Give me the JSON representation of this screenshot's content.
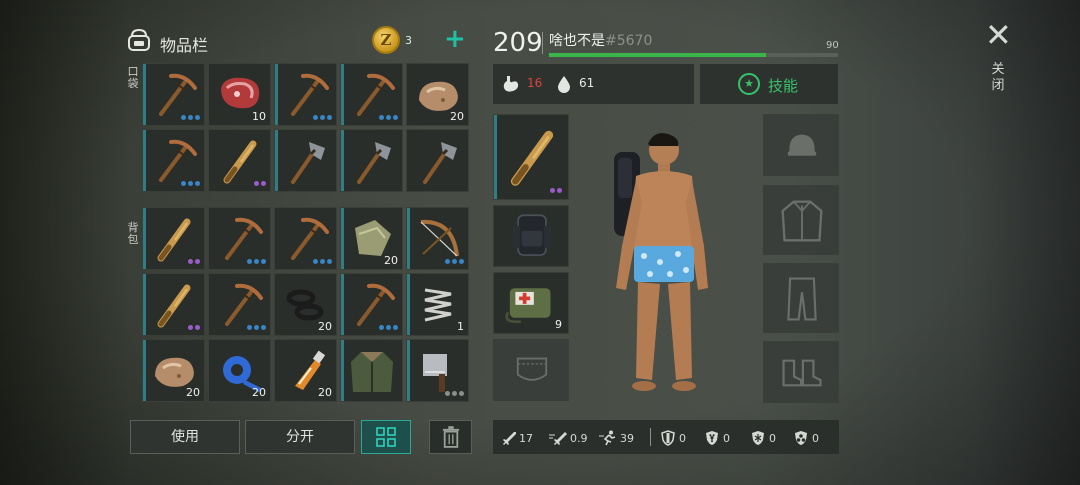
{
  "inventory": {
    "title": "物品栏",
    "coin_symbol": "Z",
    "coin_count": "3",
    "add_symbol": "+",
    "pocket_label": "口袋",
    "backpack_label": "背包",
    "pocket_slots": [
      {
        "item": "pickaxe-icon",
        "count": "",
        "dots": "blue"
      },
      {
        "item": "raw-meat-icon",
        "count": "10",
        "dots": ""
      },
      {
        "item": "pickaxe-icon",
        "count": "",
        "dots": "blue"
      },
      {
        "item": "pickaxe-icon",
        "count": "",
        "dots": "blue"
      },
      {
        "item": "stone-icon",
        "count": "20",
        "dots": ""
      },
      {
        "item": "pickaxe-icon",
        "count": "",
        "dots": "blue"
      },
      {
        "item": "wooden-club-icon",
        "count": "",
        "dots": "purple"
      },
      {
        "item": "stone-hatchet-icon",
        "count": "",
        "dots": ""
      },
      {
        "item": "stone-hatchet-icon",
        "count": "",
        "dots": ""
      },
      {
        "item": "stone-hatchet-icon",
        "count": "",
        "dots": ""
      }
    ],
    "backpack_slots": [
      {
        "item": "wooden-club-icon",
        "count": "",
        "dots": "purple"
      },
      {
        "item": "pickaxe-icon",
        "count": "",
        "dots": "blue"
      },
      {
        "item": "pickaxe-icon",
        "count": "",
        "dots": "blue"
      },
      {
        "item": "cloth-scrap-icon",
        "count": "20",
        "dots": ""
      },
      {
        "item": "bow-icon",
        "count": "",
        "dots": "blue"
      },
      {
        "item": "wooden-club-icon",
        "count": "",
        "dots": "purple"
      },
      {
        "item": "pickaxe-icon",
        "count": "",
        "dots": "blue"
      },
      {
        "item": "rubber-rings-icon",
        "count": "20",
        "dots": ""
      },
      {
        "item": "pickaxe-icon",
        "count": "",
        "dots": "blue"
      },
      {
        "item": "spring-icon",
        "count": "1",
        "dots": ""
      },
      {
        "item": "stone-icon",
        "count": "20",
        "dots": ""
      },
      {
        "item": "blue-tape-icon",
        "count": "20",
        "dots": ""
      },
      {
        "item": "glue-tube-icon",
        "count": "20",
        "dots": ""
      },
      {
        "item": "jacket-icon",
        "count": "",
        "dots": ""
      },
      {
        "item": "cleaver-icon",
        "count": "",
        "dots": "grey"
      }
    ],
    "buttons": {
      "use": "使用",
      "split": "分开"
    }
  },
  "player": {
    "level": "209",
    "name": "啥也不是",
    "tag": "#5670",
    "xp_value": "90",
    "xp_fraction": 0.75,
    "hunger": "16",
    "thirst": "61",
    "skills_label": "技能"
  },
  "equipment": {
    "left": [
      {
        "name": "weapon-slot",
        "item": "wooden-club-icon",
        "count": ""
      },
      {
        "name": "backpack-slot",
        "item": "backpack-icon",
        "count": ""
      },
      {
        "name": "medkit-slot",
        "item": "medkit-bag-icon",
        "count": "9"
      },
      {
        "name": "pocket-slot",
        "item": "pocket-icon",
        "count": ""
      }
    ],
    "right": [
      {
        "name": "head-slot",
        "item": "helmet-icon"
      },
      {
        "name": "torso-slot",
        "item": "jacket-outline-icon"
      },
      {
        "name": "legs-slot",
        "item": "pants-outline-icon"
      },
      {
        "name": "feet-slot",
        "item": "boots-outline-icon"
      }
    ]
  },
  "combat_stats": {
    "damage": "17",
    "attack_speed": "0.9",
    "move_speed": "39",
    "armor": "0",
    "radiation": "0",
    "cold": "0",
    "toxic": "0"
  },
  "close": {
    "symbol": "✕",
    "label": "关闭"
  },
  "colors": {
    "accent": "#1fc0a6",
    "xp": "#39b54a",
    "skill": "#37c26a",
    "hunger": "#d8453b"
  }
}
